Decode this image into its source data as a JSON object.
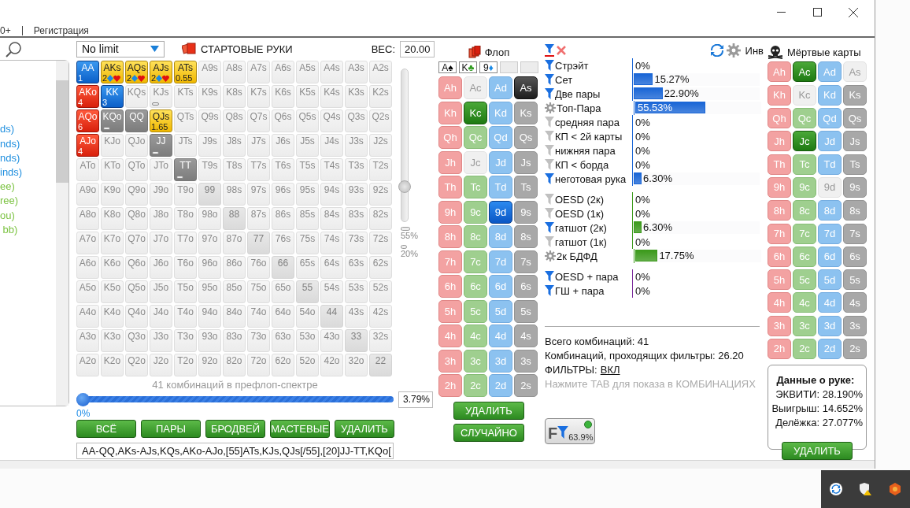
{
  "menu": {
    "items": [
      "0+",
      "Регистрация"
    ]
  },
  "left_list": {
    "items": [
      {
        "text": "ds)",
        "color": "#1f8fdf"
      },
      {
        "text": "nds)",
        "color": "#1f8fdf"
      },
      {
        "text": "nds)",
        "color": "#1f8fdf"
      },
      {
        "text": "inds)",
        "color": "#1f8fdf"
      },
      {
        "text": "ee)",
        "color": "#7cc342"
      },
      {
        "text": "ree)",
        "color": "#7cc342"
      },
      {
        "text": "ou)",
        "color": "#7cc342"
      },
      {
        "text": " bb)",
        "color": "#7cc342"
      }
    ]
  },
  "hands": {
    "game_select": "No limit",
    "title": "СТАРТОВЫЕ РУКИ",
    "weight_label": "ВЕС:",
    "weight_value": "20.00",
    "rows": [
      [
        {
          "label": "AA",
          "kind": "blue",
          "sub": "1"
        },
        {
          "label": "AKs",
          "kind": "yellow",
          "sub": "2",
          "suits": true
        },
        {
          "label": "AQs",
          "kind": "yellow",
          "sub": "2",
          "suits": true
        },
        {
          "label": "AJs",
          "kind": "yellow",
          "sub": "2",
          "suits": true
        },
        {
          "label": "ATs",
          "kind": "yellow",
          "sub": "0.55"
        },
        {
          "label": "A9s",
          "kind": "none"
        },
        {
          "label": "A8s",
          "kind": "none"
        },
        {
          "label": "A7s",
          "kind": "none"
        },
        {
          "label": "A6s",
          "kind": "none"
        },
        {
          "label": "A5s",
          "kind": "none"
        },
        {
          "label": "A4s",
          "kind": "none"
        },
        {
          "label": "A3s",
          "kind": "none"
        },
        {
          "label": "A2s",
          "kind": "none"
        }
      ],
      [
        {
          "label": "AKo",
          "kind": "red",
          "sub": "4"
        },
        {
          "label": "KK",
          "kind": "blue",
          "sub": "3"
        },
        {
          "label": "KQs",
          "kind": "none"
        },
        {
          "label": "KJs",
          "kind": "none",
          "partial": true
        },
        {
          "label": "KTs",
          "kind": "none"
        },
        {
          "label": "K9s",
          "kind": "none"
        },
        {
          "label": "K8s",
          "kind": "none"
        },
        {
          "label": "K7s",
          "kind": "none"
        },
        {
          "label": "K6s",
          "kind": "none"
        },
        {
          "label": "K5s",
          "kind": "none"
        },
        {
          "label": "K4s",
          "kind": "none"
        },
        {
          "label": "K3s",
          "kind": "none"
        },
        {
          "label": "K2s",
          "kind": "none"
        }
      ],
      [
        {
          "label": "AQo",
          "kind": "red",
          "sub": "6"
        },
        {
          "label": "KQo",
          "kind": "grey",
          "partial": true
        },
        {
          "label": "QQ",
          "kind": "grey"
        },
        {
          "label": "QJs",
          "kind": "yellow",
          "sub": "1.65"
        },
        {
          "label": "QTs",
          "kind": "none"
        },
        {
          "label": "Q9s",
          "kind": "none"
        },
        {
          "label": "Q8s",
          "kind": "none"
        },
        {
          "label": "Q7s",
          "kind": "none"
        },
        {
          "label": "Q6s",
          "kind": "none"
        },
        {
          "label": "Q5s",
          "kind": "none"
        },
        {
          "label": "Q4s",
          "kind": "none"
        },
        {
          "label": "Q3s",
          "kind": "none"
        },
        {
          "label": "Q2s",
          "kind": "none"
        }
      ],
      [
        {
          "label": "AJo",
          "kind": "red",
          "sub": "4"
        },
        {
          "label": "KJo",
          "kind": "none"
        },
        {
          "label": "QJo",
          "kind": "none"
        },
        {
          "label": "JJ",
          "kind": "grey",
          "partial": true
        },
        {
          "label": "JTs",
          "kind": "none"
        },
        {
          "label": "J9s",
          "kind": "none"
        },
        {
          "label": "J8s",
          "kind": "none"
        },
        {
          "label": "J7s",
          "kind": "none"
        },
        {
          "label": "J6s",
          "kind": "none"
        },
        {
          "label": "J5s",
          "kind": "none"
        },
        {
          "label": "J4s",
          "kind": "none"
        },
        {
          "label": "J3s",
          "kind": "none"
        },
        {
          "label": "J2s",
          "kind": "none"
        }
      ],
      [
        {
          "label": "ATo",
          "kind": "none"
        },
        {
          "label": "KTo",
          "kind": "none"
        },
        {
          "label": "QTo",
          "kind": "none"
        },
        {
          "label": "JTo",
          "kind": "none"
        },
        {
          "label": "TT",
          "kind": "grey",
          "partial": true
        },
        {
          "label": "T9s",
          "kind": "none"
        },
        {
          "label": "T8s",
          "kind": "none"
        },
        {
          "label": "T7s",
          "kind": "none"
        },
        {
          "label": "T6s",
          "kind": "none"
        },
        {
          "label": "T5s",
          "kind": "none"
        },
        {
          "label": "T4s",
          "kind": "none"
        },
        {
          "label": "T3s",
          "kind": "none"
        },
        {
          "label": "T2s",
          "kind": "none"
        }
      ],
      [
        {
          "label": "A9o",
          "kind": "none"
        },
        {
          "label": "K9o",
          "kind": "none"
        },
        {
          "label": "Q9o",
          "kind": "none"
        },
        {
          "label": "J9o",
          "kind": "none"
        },
        {
          "label": "T9o",
          "kind": "none"
        },
        {
          "label": "99",
          "kind": "pair"
        },
        {
          "label": "98s",
          "kind": "none"
        },
        {
          "label": "97s",
          "kind": "none"
        },
        {
          "label": "96s",
          "kind": "none"
        },
        {
          "label": "95s",
          "kind": "none"
        },
        {
          "label": "94s",
          "kind": "none"
        },
        {
          "label": "93s",
          "kind": "none"
        },
        {
          "label": "92s",
          "kind": "none"
        }
      ],
      [
        {
          "label": "A8o",
          "kind": "none"
        },
        {
          "label": "K8o",
          "kind": "none"
        },
        {
          "label": "Q8o",
          "kind": "none"
        },
        {
          "label": "J8o",
          "kind": "none"
        },
        {
          "label": "T8o",
          "kind": "none"
        },
        {
          "label": "98o",
          "kind": "none"
        },
        {
          "label": "88",
          "kind": "pair"
        },
        {
          "label": "87s",
          "kind": "none"
        },
        {
          "label": "86s",
          "kind": "none"
        },
        {
          "label": "85s",
          "kind": "none"
        },
        {
          "label": "84s",
          "kind": "none"
        },
        {
          "label": "83s",
          "kind": "none"
        },
        {
          "label": "82s",
          "kind": "none"
        }
      ],
      [
        {
          "label": "A7o",
          "kind": "none"
        },
        {
          "label": "K7o",
          "kind": "none"
        },
        {
          "label": "Q7o",
          "kind": "none"
        },
        {
          "label": "J7o",
          "kind": "none"
        },
        {
          "label": "T7o",
          "kind": "none"
        },
        {
          "label": "97o",
          "kind": "none"
        },
        {
          "label": "87o",
          "kind": "none"
        },
        {
          "label": "77",
          "kind": "pair"
        },
        {
          "label": "76s",
          "kind": "none"
        },
        {
          "label": "75s",
          "kind": "none"
        },
        {
          "label": "74s",
          "kind": "none"
        },
        {
          "label": "73s",
          "kind": "none"
        },
        {
          "label": "72s",
          "kind": "none"
        }
      ],
      [
        {
          "label": "A6o",
          "kind": "none"
        },
        {
          "label": "K6o",
          "kind": "none"
        },
        {
          "label": "Q6o",
          "kind": "none"
        },
        {
          "label": "J6o",
          "kind": "none"
        },
        {
          "label": "T6o",
          "kind": "none"
        },
        {
          "label": "96o",
          "kind": "none"
        },
        {
          "label": "86o",
          "kind": "none"
        },
        {
          "label": "76o",
          "kind": "none"
        },
        {
          "label": "66",
          "kind": "pair"
        },
        {
          "label": "65s",
          "kind": "none"
        },
        {
          "label": "64s",
          "kind": "none"
        },
        {
          "label": "63s",
          "kind": "none"
        },
        {
          "label": "62s",
          "kind": "none"
        }
      ],
      [
        {
          "label": "A5o",
          "kind": "none"
        },
        {
          "label": "K5o",
          "kind": "none"
        },
        {
          "label": "Q5o",
          "kind": "none"
        },
        {
          "label": "J5o",
          "kind": "none"
        },
        {
          "label": "T5o",
          "kind": "none"
        },
        {
          "label": "95o",
          "kind": "none"
        },
        {
          "label": "85o",
          "kind": "none"
        },
        {
          "label": "75o",
          "kind": "none"
        },
        {
          "label": "65o",
          "kind": "none"
        },
        {
          "label": "55",
          "kind": "pair"
        },
        {
          "label": "54s",
          "kind": "none"
        },
        {
          "label": "53s",
          "kind": "none"
        },
        {
          "label": "52s",
          "kind": "none"
        }
      ],
      [
        {
          "label": "A4o",
          "kind": "none"
        },
        {
          "label": "K4o",
          "kind": "none"
        },
        {
          "label": "Q4o",
          "kind": "none"
        },
        {
          "label": "J4o",
          "kind": "none"
        },
        {
          "label": "T4o",
          "kind": "none"
        },
        {
          "label": "94o",
          "kind": "none"
        },
        {
          "label": "84o",
          "kind": "none"
        },
        {
          "label": "74o",
          "kind": "none"
        },
        {
          "label": "64o",
          "kind": "none"
        },
        {
          "label": "54o",
          "kind": "none"
        },
        {
          "label": "44",
          "kind": "pair"
        },
        {
          "label": "43s",
          "kind": "none"
        },
        {
          "label": "42s",
          "kind": "none"
        }
      ],
      [
        {
          "label": "A3o",
          "kind": "none"
        },
        {
          "label": "K3o",
          "kind": "none"
        },
        {
          "label": "Q3o",
          "kind": "none"
        },
        {
          "label": "J3o",
          "kind": "none"
        },
        {
          "label": "T3o",
          "kind": "none"
        },
        {
          "label": "93o",
          "kind": "none"
        },
        {
          "label": "83o",
          "kind": "none"
        },
        {
          "label": "73o",
          "kind": "none"
        },
        {
          "label": "63o",
          "kind": "none"
        },
        {
          "label": "53o",
          "kind": "none"
        },
        {
          "label": "43o",
          "kind": "none"
        },
        {
          "label": "33",
          "kind": "pair"
        },
        {
          "label": "32s",
          "kind": "none"
        }
      ],
      [
        {
          "label": "A2o",
          "kind": "none"
        },
        {
          "label": "K2o",
          "kind": "none"
        },
        {
          "label": "Q2o",
          "kind": "none"
        },
        {
          "label": "J2o",
          "kind": "none"
        },
        {
          "label": "T2o",
          "kind": "none"
        },
        {
          "label": "92o",
          "kind": "none"
        },
        {
          "label": "82o",
          "kind": "none"
        },
        {
          "label": "72o",
          "kind": "none"
        },
        {
          "label": "62o",
          "kind": "none"
        },
        {
          "label": "52o",
          "kind": "none"
        },
        {
          "label": "42o",
          "kind": "none"
        },
        {
          "label": "32o",
          "kind": "none"
        },
        {
          "label": "22",
          "kind": "pair"
        }
      ]
    ],
    "weight_slider": {
      "level": 0.22,
      "marks": [
        "55%",
        "20%"
      ]
    },
    "combos_caption": "41 комбинаций в префлоп-спектре",
    "range_slider": {
      "level": 0,
      "min_label": "0%",
      "value": "3.79%"
    },
    "buttons": [
      "ВСЁ",
      "ПАРЫ",
      "БРОДВЕЙ",
      "МАСТЕВЫЕ",
      "УДАЛИТЬ"
    ],
    "range_text": "AA-QQ,AKs-AJs,KQs,AKo-AJo,[55]ATs,KJs,QJs[/55],[20]JJ-TT,KQo["
  },
  "flop": {
    "title": "Флоп",
    "board": [
      {
        "kind": "card",
        "rank": "A",
        "suit": "♠",
        "color": "#000000"
      },
      {
        "kind": "card",
        "rank": "K",
        "suit": "♣",
        "color": "#2e9a1e"
      },
      {
        "kind": "card",
        "rank": "9",
        "suit": "♦",
        "color": "#1a8ae6"
      },
      {
        "kind": "empty"
      },
      {
        "kind": "empty"
      }
    ],
    "card_rows": [
      [
        {
          "label": "Ah",
          "kind": "hearts",
          "selected": false,
          "disabled": false
        },
        {
          "label": "Ac",
          "kind": "clubs",
          "selected": false,
          "disabled": true
        },
        {
          "label": "Ad",
          "kind": "diamonds",
          "selected": false,
          "disabled": false
        },
        {
          "label": "As",
          "kind": "spades",
          "selected": true,
          "disabled": false
        }
      ],
      [
        {
          "label": "Kh",
          "kind": "hearts",
          "selected": false,
          "disabled": false
        },
        {
          "label": "Kc",
          "kind": "clubs",
          "selected": true,
          "disabled": false
        },
        {
          "label": "Kd",
          "kind": "diamonds",
          "selected": false,
          "disabled": false
        },
        {
          "label": "Ks",
          "kind": "spades",
          "selected": false,
          "disabled": false
        }
      ],
      [
        {
          "label": "Qh",
          "kind": "hearts",
          "selected": false,
          "disabled": false
        },
        {
          "label": "Qc",
          "kind": "clubs",
          "selected": false,
          "disabled": false
        },
        {
          "label": "Qd",
          "kind": "diamonds",
          "selected": false,
          "disabled": false
        },
        {
          "label": "Qs",
          "kind": "spades",
          "selected": false,
          "disabled": false
        }
      ],
      [
        {
          "label": "Jh",
          "kind": "hearts",
          "selected": false,
          "disabled": false
        },
        {
          "label": "Jc",
          "kind": "clubs",
          "selected": false,
          "disabled": true
        },
        {
          "label": "Jd",
          "kind": "diamonds",
          "selected": false,
          "disabled": false
        },
        {
          "label": "Js",
          "kind": "spades",
          "selected": false,
          "disabled": false
        }
      ],
      [
        {
          "label": "Th",
          "kind": "hearts",
          "selected": false,
          "disabled": false
        },
        {
          "label": "Tc",
          "kind": "clubs",
          "selected": false,
          "disabled": false
        },
        {
          "label": "Td",
          "kind": "diamonds",
          "selected": false,
          "disabled": false
        },
        {
          "label": "Ts",
          "kind": "spades",
          "selected": false,
          "disabled": false
        }
      ],
      [
        {
          "label": "9h",
          "kind": "hearts",
          "selected": false,
          "disabled": false
        },
        {
          "label": "9c",
          "kind": "clubs",
          "selected": false,
          "disabled": false
        },
        {
          "label": "9d",
          "kind": "diamonds",
          "selected": true,
          "disabled": false
        },
        {
          "label": "9s",
          "kind": "spades",
          "selected": false,
          "disabled": false
        }
      ],
      [
        {
          "label": "8h",
          "kind": "hearts",
          "selected": false,
          "disabled": false
        },
        {
          "label": "8c",
          "kind": "clubs",
          "selected": false,
          "disabled": false
        },
        {
          "label": "8d",
          "kind": "diamonds",
          "selected": false,
          "disabled": false
        },
        {
          "label": "8s",
          "kind": "spades",
          "selected": false,
          "disabled": false
        }
      ],
      [
        {
          "label": "7h",
          "kind": "hearts",
          "selected": false,
          "disabled": false
        },
        {
          "label": "7c",
          "kind": "clubs",
          "selected": false,
          "disabled": false
        },
        {
          "label": "7d",
          "kind": "diamonds",
          "selected": false,
          "disabled": false
        },
        {
          "label": "7s",
          "kind": "spades",
          "selected": false,
          "disabled": false
        }
      ],
      [
        {
          "label": "6h",
          "kind": "hearts",
          "selected": false,
          "disabled": false
        },
        {
          "label": "6c",
          "kind": "clubs",
          "selected": false,
          "disabled": false
        },
        {
          "label": "6d",
          "kind": "diamonds",
          "selected": false,
          "disabled": false
        },
        {
          "label": "6s",
          "kind": "spades",
          "selected": false,
          "disabled": false
        }
      ],
      [
        {
          "label": "5h",
          "kind": "hearts",
          "selected": false,
          "disabled": false
        },
        {
          "label": "5c",
          "kind": "clubs",
          "selected": false,
          "disabled": false
        },
        {
          "label": "5d",
          "kind": "diamonds",
          "selected": false,
          "disabled": false
        },
        {
          "label": "5s",
          "kind": "spades",
          "selected": false,
          "disabled": false
        }
      ],
      [
        {
          "label": "4h",
          "kind": "hearts",
          "selected": false,
          "disabled": false
        },
        {
          "label": "4c",
          "kind": "clubs",
          "selected": false,
          "disabled": false
        },
        {
          "label": "4d",
          "kind": "diamonds",
          "selected": false,
          "disabled": false
        },
        {
          "label": "4s",
          "kind": "spades",
          "selected": false,
          "disabled": false
        }
      ],
      [
        {
          "label": "3h",
          "kind": "hearts",
          "selected": false,
          "disabled": false
        },
        {
          "label": "3c",
          "kind": "clubs",
          "selected": false,
          "disabled": false
        },
        {
          "label": "3d",
          "kind": "diamonds",
          "selected": false,
          "disabled": false
        },
        {
          "label": "3s",
          "kind": "spades",
          "selected": false,
          "disabled": false
        }
      ],
      [
        {
          "label": "2h",
          "kind": "hearts",
          "selected": false,
          "disabled": false
        },
        {
          "label": "2c",
          "kind": "clubs",
          "selected": false,
          "disabled": false
        },
        {
          "label": "2d",
          "kind": "diamonds",
          "selected": false,
          "disabled": false
        },
        {
          "label": "2s",
          "kind": "spades",
          "selected": false,
          "disabled": false
        }
      ]
    ],
    "buttons": [
      "УДАЛИТЬ",
      "СЛУЧАЙНО"
    ]
  },
  "stats": {
    "inv_label": "Инв",
    "groups": [
      {
        "color": "#1a66d6",
        "rows": [
          {
            "kind": "filter",
            "label": "Стрэйт",
            "value": "0%"
          },
          {
            "kind": "filter",
            "label": "Сет",
            "value": "15.27%",
            "level": 0.1527
          },
          {
            "kind": "filter",
            "label": "Две пары",
            "value": "22.90%",
            "level": 0.229
          },
          {
            "kind": "gear",
            "label": "Топ-Пара",
            "value": "55.53%",
            "level": 0.5553
          },
          {
            "kind": "muted",
            "label": "средняя пара",
            "value": "0%"
          },
          {
            "kind": "muted",
            "label": "КП < 2й карты",
            "value": "0%"
          },
          {
            "kind": "muted",
            "label": "нижняя пара",
            "value": "0%"
          },
          {
            "kind": "muted",
            "label": "КП < борда",
            "value": "0%"
          },
          {
            "kind": "filter",
            "label": "неготовая рука",
            "value": "6.30%",
            "level": 0.063
          }
        ]
      },
      {
        "color": "#3c9a1c",
        "rows": [
          {
            "kind": "muted",
            "label": "OESD (2к)",
            "value": "0%"
          },
          {
            "kind": "muted",
            "label": "OESD (1к)",
            "value": "0%"
          },
          {
            "kind": "filter",
            "label": "гатшот (2к)",
            "value": "6.30%",
            "level": 0.063
          },
          {
            "kind": "muted",
            "label": "гатшот (1к)",
            "value": "0%"
          },
          {
            "kind": "gear",
            "label": "2к БДФД",
            "value": "17.75%",
            "level": 0.1775
          }
        ]
      },
      {
        "color": "#7a2a9a",
        "rows": [
          {
            "kind": "filter",
            "label": "OESD + пара",
            "value": "0%"
          },
          {
            "kind": "filter",
            "label": "ГШ + пара",
            "value": "0%"
          }
        ]
      }
    ],
    "total": "Всего комбинаций: 41",
    "passing": "Комбинаций, проходящих фильтры: 26.20",
    "filters_label": "ФИЛЬТРЫ:",
    "filters_link": "ВКЛ",
    "hint": "Нажмите TAB для показа в КОМБИНАЦИЯХ",
    "filter_button": {
      "letter": "F",
      "value": "63.9%",
      "on": true
    }
  },
  "dead": {
    "title": "Мёртвые карты",
    "card_rows": [
      [
        {
          "label": "Ah",
          "kind": "hearts",
          "selected": false,
          "disabled": false
        },
        {
          "label": "Ac",
          "kind": "clubs",
          "selected": true,
          "disabled": false
        },
        {
          "label": "Ad",
          "kind": "diamonds",
          "selected": false,
          "disabled": false
        },
        {
          "label": "As",
          "kind": "spades",
          "selected": false,
          "disabled": true
        }
      ],
      [
        {
          "label": "Kh",
          "kind": "hearts",
          "selected": false,
          "disabled": false
        },
        {
          "label": "Kc",
          "kind": "clubs",
          "selected": false,
          "disabled": true
        },
        {
          "label": "Kd",
          "kind": "diamonds",
          "selected": false,
          "disabled": false
        },
        {
          "label": "Ks",
          "kind": "spades",
          "selected": false,
          "disabled": false
        }
      ],
      [
        {
          "label": "Qh",
          "kind": "hearts",
          "selected": false,
          "disabled": false
        },
        {
          "label": "Qc",
          "kind": "clubs",
          "selected": false,
          "disabled": false
        },
        {
          "label": "Qd",
          "kind": "diamonds",
          "selected": false,
          "disabled": false
        },
        {
          "label": "Qs",
          "kind": "spades",
          "selected": false,
          "disabled": false
        }
      ],
      [
        {
          "label": "Jh",
          "kind": "hearts",
          "selected": false,
          "disabled": false
        },
        {
          "label": "Jc",
          "kind": "clubs",
          "selected": true,
          "disabled": false
        },
        {
          "label": "Jd",
          "kind": "diamonds",
          "selected": false,
          "disabled": false
        },
        {
          "label": "Js",
          "kind": "spades",
          "selected": false,
          "disabled": false
        }
      ],
      [
        {
          "label": "Th",
          "kind": "hearts",
          "selected": false,
          "disabled": false
        },
        {
          "label": "Tc",
          "kind": "clubs",
          "selected": false,
          "disabled": false
        },
        {
          "label": "Td",
          "kind": "diamonds",
          "selected": false,
          "disabled": false
        },
        {
          "label": "Ts",
          "kind": "spades",
          "selected": false,
          "disabled": false
        }
      ],
      [
        {
          "label": "9h",
          "kind": "hearts",
          "selected": false,
          "disabled": false
        },
        {
          "label": "9c",
          "kind": "clubs",
          "selected": false,
          "disabled": false
        },
        {
          "label": "9d",
          "kind": "diamonds",
          "selected": false,
          "disabled": true
        },
        {
          "label": "9s",
          "kind": "spades",
          "selected": false,
          "disabled": false
        }
      ],
      [
        {
          "label": "8h",
          "kind": "hearts",
          "selected": false,
          "disabled": false
        },
        {
          "label": "8c",
          "kind": "clubs",
          "selected": false,
          "disabled": false
        },
        {
          "label": "8d",
          "kind": "diamonds",
          "selected": false,
          "disabled": false
        },
        {
          "label": "8s",
          "kind": "spades",
          "selected": false,
          "disabled": false
        }
      ],
      [
        {
          "label": "7h",
          "kind": "hearts",
          "selected": false,
          "disabled": false
        },
        {
          "label": "7c",
          "kind": "clubs",
          "selected": false,
          "disabled": false
        },
        {
          "label": "7d",
          "kind": "diamonds",
          "selected": false,
          "disabled": false
        },
        {
          "label": "7s",
          "kind": "spades",
          "selected": false,
          "disabled": false
        }
      ],
      [
        {
          "label": "6h",
          "kind": "hearts",
          "selected": false,
          "disabled": false
        },
        {
          "label": "6c",
          "kind": "clubs",
          "selected": false,
          "disabled": false
        },
        {
          "label": "6d",
          "kind": "diamonds",
          "selected": false,
          "disabled": false
        },
        {
          "label": "6s",
          "kind": "spades",
          "selected": false,
          "disabled": false
        }
      ],
      [
        {
          "label": "5h",
          "kind": "hearts",
          "selected": false,
          "disabled": false
        },
        {
          "label": "5c",
          "kind": "clubs",
          "selected": false,
          "disabled": false
        },
        {
          "label": "5d",
          "kind": "diamonds",
          "selected": false,
          "disabled": false
        },
        {
          "label": "5s",
          "kind": "spades",
          "selected": false,
          "disabled": false
        }
      ],
      [
        {
          "label": "4h",
          "kind": "hearts",
          "selected": false,
          "disabled": false
        },
        {
          "label": "4c",
          "kind": "clubs",
          "selected": false,
          "disabled": false
        },
        {
          "label": "4d",
          "kind": "diamonds",
          "selected": false,
          "disabled": false
        },
        {
          "label": "4s",
          "kind": "spades",
          "selected": false,
          "disabled": false
        }
      ],
      [
        {
          "label": "3h",
          "kind": "hearts",
          "selected": false,
          "disabled": false
        },
        {
          "label": "3c",
          "kind": "clubs",
          "selected": false,
          "disabled": false
        },
        {
          "label": "3d",
          "kind": "diamonds",
          "selected": false,
          "disabled": false
        },
        {
          "label": "3s",
          "kind": "spades",
          "selected": false,
          "disabled": false
        }
      ],
      [
        {
          "label": "2h",
          "kind": "hearts",
          "selected": false,
          "disabled": false
        },
        {
          "label": "2c",
          "kind": "clubs",
          "selected": false,
          "disabled": false
        },
        {
          "label": "2d",
          "kind": "diamonds",
          "selected": false,
          "disabled": false
        },
        {
          "label": "2s",
          "kind": "spades",
          "selected": false,
          "disabled": false
        }
      ]
    ],
    "hand_info": {
      "title": "Данные о руке:",
      "lines": [
        "ЭКВИТИ: 28.190%",
        "Выигрыш: 14.652%",
        "Делёжка: 27.077%"
      ]
    },
    "button": "УДАЛИТЬ"
  }
}
